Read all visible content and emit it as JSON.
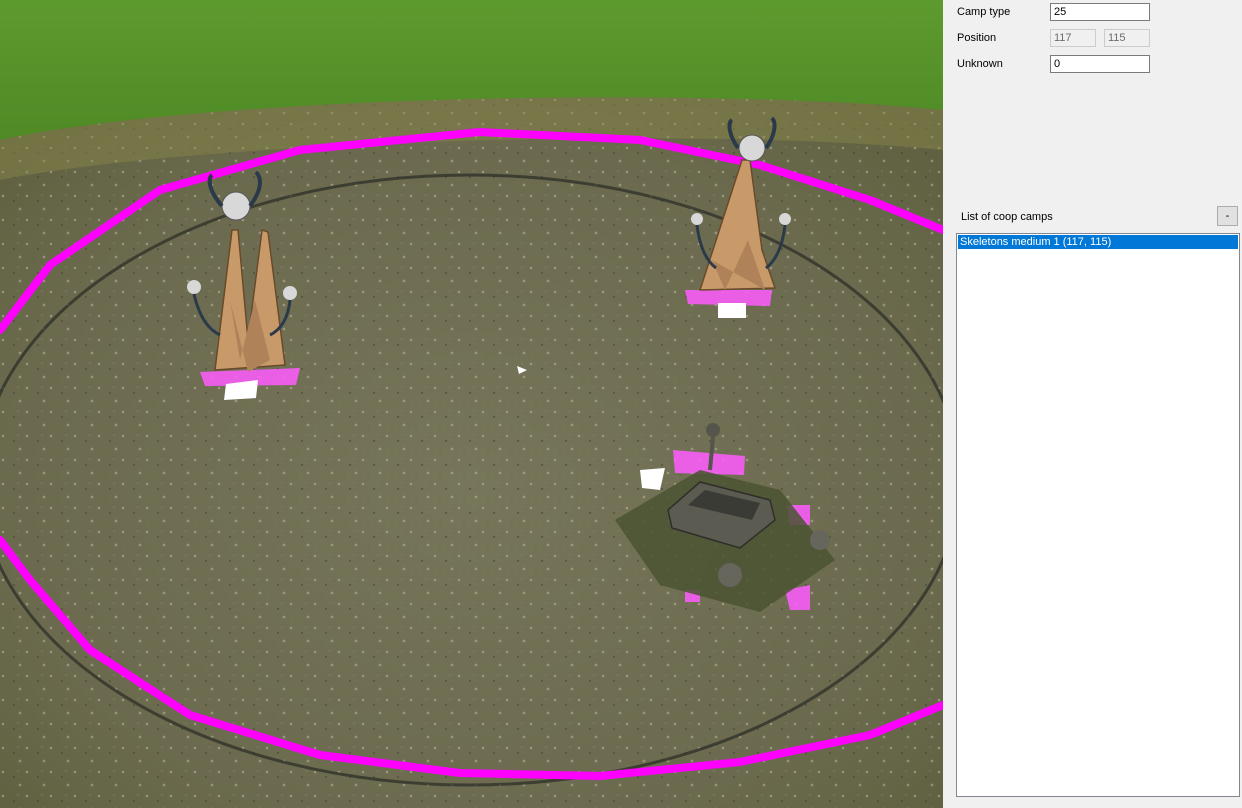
{
  "panel": {
    "camp_type_label": "Camp type",
    "camp_type_value": "25",
    "position_label": "Position",
    "position_x": "117",
    "position_y": "115",
    "unknown_label": "Unknown",
    "unknown_value": "0",
    "list_label": "List of coop camps",
    "remove_label": "-",
    "camps": [
      "Skeletons medium 1 (117, 115)"
    ]
  },
  "viewport": {
    "camp_ring_color": "#ff00ff",
    "grass_color": "#5f9a2f",
    "ground_color": "#6f6e52"
  }
}
